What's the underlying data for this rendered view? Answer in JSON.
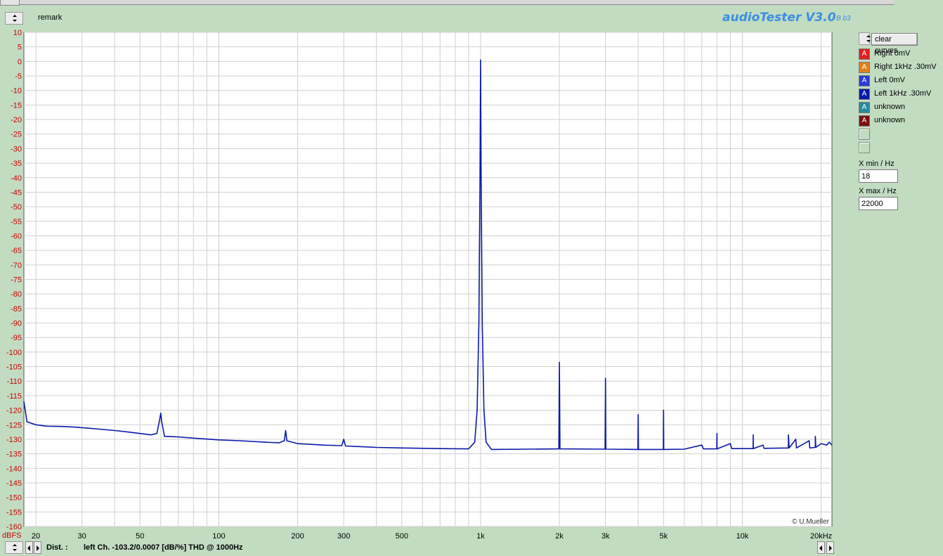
{
  "header": {
    "remark_label": "remark",
    "brand": "audioTester V3.0",
    "brand_sub": "B b3"
  },
  "panel": {
    "clear_button": "clear curves",
    "legend": [
      {
        "label": "Right 0mV",
        "color": "#e02020"
      },
      {
        "label": "Right 1kHz .30mV",
        "color": "#e08020"
      },
      {
        "label": "Left 0mV",
        "color": "#2a3ad8"
      },
      {
        "label": "Left 1kHz .30mV",
        "color": "#0a1aa8"
      },
      {
        "label": "unknown",
        "color": "#2a8a9a"
      },
      {
        "label": "unknown",
        "color": "#7a1010"
      }
    ],
    "swatch_letter": "A",
    "xmin_label": "X min / Hz",
    "xmin_value": "18",
    "xmax_label": "X max / Hz",
    "xmax_value": "22000"
  },
  "status": {
    "dist_label": "Dist. :",
    "dist_text": "left Ch. -103.2/0.0007 [dB/%] THD @ 1000Hz"
  },
  "chart_data": {
    "type": "line",
    "ylabel": "dBFS",
    "xscale": "log",
    "xlim": [
      18,
      22000
    ],
    "ylim": [
      -160,
      10
    ],
    "y_ticks": [
      10,
      5,
      0,
      -5,
      -10,
      -15,
      -20,
      -25,
      -30,
      -35,
      -40,
      -45,
      -50,
      -55,
      -60,
      -65,
      -70,
      -75,
      -80,
      -85,
      -90,
      -95,
      -100,
      -105,
      -110,
      -115,
      -120,
      -125,
      -130,
      -135,
      -140,
      -145,
      -150,
      -155,
      -160
    ],
    "x_ticks": [
      {
        "value": 20,
        "label": "20"
      },
      {
        "value": 30,
        "label": "30"
      },
      {
        "value": 50,
        "label": "50"
      },
      {
        "value": 100,
        "label": "100"
      },
      {
        "value": 200,
        "label": "200"
      },
      {
        "value": 300,
        "label": "300"
      },
      {
        "value": 500,
        "label": "500"
      },
      {
        "value": 1000,
        "label": "1k"
      },
      {
        "value": 2000,
        "label": "2k"
      },
      {
        "value": 3000,
        "label": "3k"
      },
      {
        "value": 5000,
        "label": "5k"
      },
      {
        "value": 10000,
        "label": "10k"
      },
      {
        "value": 20000,
        "label": "20kHz"
      }
    ],
    "grid": true,
    "credit": "© U.Mueller",
    "series": [
      {
        "name": "Left 1kHz .30mV",
        "color": "#0a1aa8",
        "points": [
          [
            18,
            -117
          ],
          [
            18.5,
            -124
          ],
          [
            20,
            -125
          ],
          [
            22,
            -125.5
          ],
          [
            25,
            -125.6
          ],
          [
            28,
            -125.8
          ],
          [
            30,
            -126
          ],
          [
            35,
            -126.5
          ],
          [
            40,
            -127
          ],
          [
            45,
            -127.5
          ],
          [
            50,
            -128
          ],
          [
            55,
            -128.5
          ],
          [
            58,
            -128
          ],
          [
            59.5,
            -123
          ],
          [
            60,
            -121
          ],
          [
            60.5,
            -124
          ],
          [
            62,
            -129
          ],
          [
            70,
            -129.2
          ],
          [
            80,
            -129.6
          ],
          [
            100,
            -130.2
          ],
          [
            120,
            -130.5
          ],
          [
            150,
            -131
          ],
          [
            170,
            -131.2
          ],
          [
            178,
            -130.5
          ],
          [
            180,
            -127
          ],
          [
            182,
            -130.5
          ],
          [
            200,
            -131.5
          ],
          [
            250,
            -132
          ],
          [
            295,
            -132.2
          ],
          [
            300,
            -130
          ],
          [
            305,
            -132.3
          ],
          [
            400,
            -132.8
          ],
          [
            500,
            -133
          ],
          [
            700,
            -133.2
          ],
          [
            900,
            -133.3
          ],
          [
            950,
            -131
          ],
          [
            970,
            -120
          ],
          [
            985,
            -90
          ],
          [
            995,
            -40
          ],
          [
            1000,
            0.5
          ],
          [
            1005,
            -40
          ],
          [
            1015,
            -90
          ],
          [
            1030,
            -120
          ],
          [
            1050,
            -131
          ],
          [
            1100,
            -133.5
          ],
          [
            1500,
            -133.4
          ],
          [
            1990,
            -133.3
          ],
          [
            2000,
            -103.5
          ],
          [
            2010,
            -133.3
          ],
          [
            2990,
            -133.4
          ],
          [
            3000,
            -109
          ],
          [
            3010,
            -133.4
          ],
          [
            3990,
            -133.5
          ],
          [
            4000,
            -121.5
          ],
          [
            4010,
            -133.5
          ],
          [
            4990,
            -133.5
          ],
          [
            5000,
            -120
          ],
          [
            5010,
            -133.5
          ],
          [
            6000,
            -133.4
          ],
          [
            7000,
            -132
          ],
          [
            7100,
            -133.3
          ],
          [
            7990,
            -133.3
          ],
          [
            8000,
            -128
          ],
          [
            8010,
            -133.3
          ],
          [
            9000,
            -131.5
          ],
          [
            9100,
            -133.2
          ],
          [
            10990,
            -133.2
          ],
          [
            11000,
            -128.5
          ],
          [
            11010,
            -133.2
          ],
          [
            12000,
            -132
          ],
          [
            12100,
            -133.1
          ],
          [
            14990,
            -133
          ],
          [
            15000,
            -128.5
          ],
          [
            15100,
            -133
          ],
          [
            16000,
            -130
          ],
          [
            16100,
            -133
          ],
          [
            18000,
            -130.5
          ],
          [
            18100,
            -133
          ],
          [
            18990,
            -132.8
          ],
          [
            19000,
            -129
          ],
          [
            19100,
            -132.8
          ],
          [
            20000,
            -131.5
          ],
          [
            21000,
            -132
          ],
          [
            21500,
            -131
          ],
          [
            22000,
            -132
          ]
        ]
      }
    ]
  }
}
